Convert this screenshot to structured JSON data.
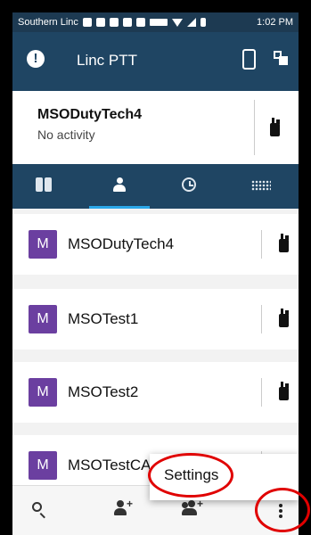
{
  "status_bar": {
    "carrier": "Southern Linc",
    "time": "1:02 PM"
  },
  "app_bar": {
    "title": "Linc PTT",
    "alert_icon": "!"
  },
  "contact_header": {
    "name": "MSODutyTech4",
    "status": "No activity"
  },
  "tabs": [
    {
      "icon": "walkie-talkie-icon"
    },
    {
      "icon": "person-icon",
      "active": true
    },
    {
      "icon": "clock-icon"
    },
    {
      "icon": "keypad-icon"
    }
  ],
  "contacts": [
    {
      "initial": "M",
      "name": "MSODutyTech4"
    },
    {
      "initial": "M",
      "name": "MSOTest1"
    },
    {
      "initial": "M",
      "name": "MSOTest2"
    },
    {
      "initial": "M",
      "name": "MSOTestCATS"
    }
  ],
  "menu": {
    "settings_label": "Settings"
  },
  "colors": {
    "header": "#1f4563",
    "tab_indicator": "#2aa7e8",
    "avatar": "#6b3fa0",
    "annotation": "#e00000"
  }
}
